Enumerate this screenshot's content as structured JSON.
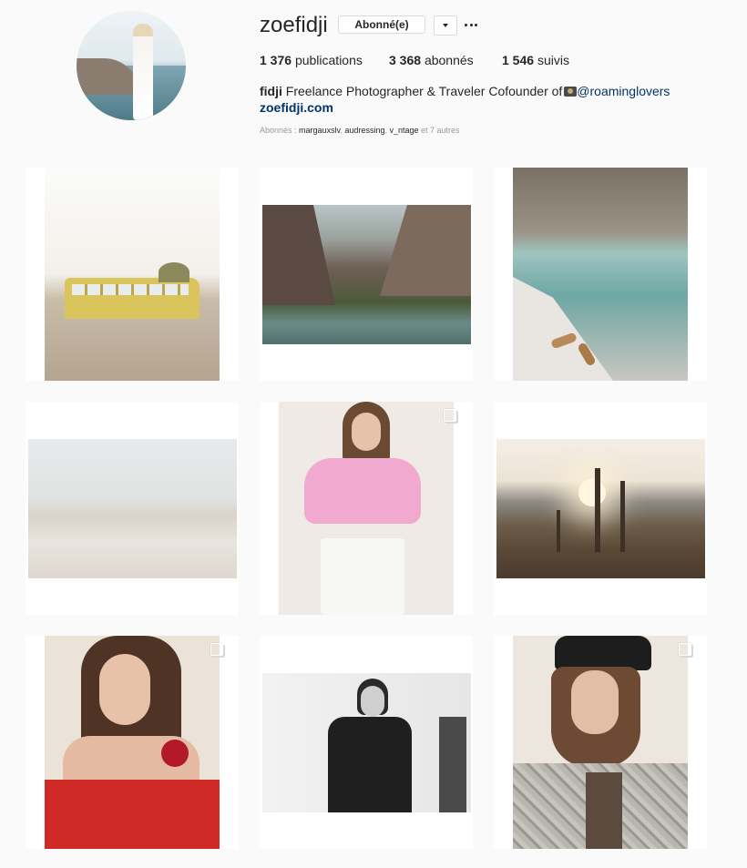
{
  "profile": {
    "username": "zoefidji",
    "follow_label": "Abonné(e)",
    "stats": [
      {
        "value": "1 376",
        "label": "publications"
      },
      {
        "value": "3 368",
        "label": "abonnés"
      },
      {
        "value": "1 546",
        "label": "suivis"
      }
    ],
    "bio": {
      "name": "fidji",
      "text": "Freelance Photographer & Traveler Cofounder of",
      "handle": "@roaminglovers"
    },
    "website": "zoefidji.com",
    "followed_by": {
      "prefix": "Abonnés :",
      "names": [
        "margauxslv",
        "audressing",
        "v_ntage"
      ],
      "suffix": "et 7 autres"
    }
  },
  "posts": [
    {
      "subject": "yellow bus desert",
      "multi": false
    },
    {
      "subject": "canyon oasis",
      "multi": false
    },
    {
      "subject": "turquoise river sandals",
      "multi": false
    },
    {
      "subject": "sand dunes",
      "multi": false
    },
    {
      "subject": "pink top portrait",
      "multi": true
    },
    {
      "subject": "joshua trees sunset",
      "multi": false
    },
    {
      "subject": "red top portrait",
      "multi": true
    },
    {
      "subject": "black and white man portrait",
      "multi": false
    },
    {
      "subject": "cap plaid blazer portrait",
      "multi": true
    }
  ]
}
